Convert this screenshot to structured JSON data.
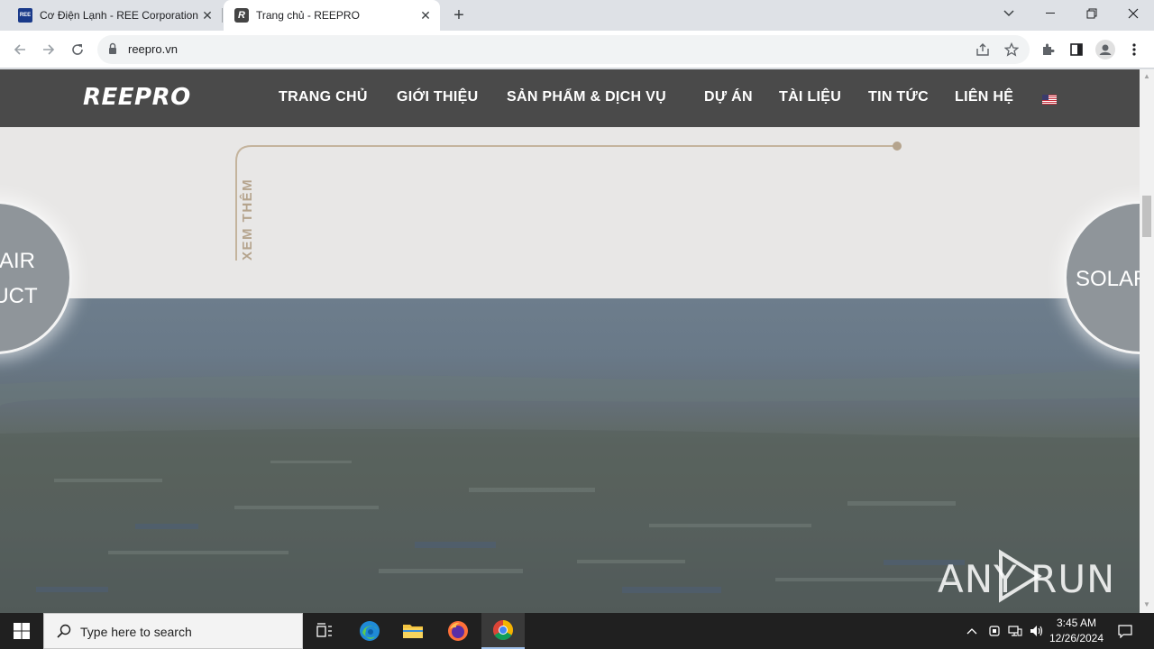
{
  "browser": {
    "tabs": [
      {
        "title": "Cơ Điện Lạnh - REE Corporation",
        "favicon": "REE",
        "active": false
      },
      {
        "title": "Trang chủ - REEPRO",
        "favicon": "R",
        "active": true
      }
    ],
    "address": "reepro.vn",
    "window_controls": [
      "tab-search",
      "minimize",
      "restore",
      "close"
    ]
  },
  "site": {
    "logo": "REEPRO",
    "menu": [
      "TRANG CHỦ",
      "GIỚI THIỆU",
      "SẢN PHẨM & DỊCH VỤ",
      "DỰ ÁN",
      "TÀI LIỆU",
      "TIN TỨC",
      "LIÊN HỆ"
    ],
    "language_flag": "us-flag-icon",
    "xem_them": "XEM THÊM",
    "left_circle": {
      "line1": "AIR",
      "line2": "DUCT"
    },
    "right_circle": {
      "line1": "SOLAR"
    }
  },
  "watermark": "ANY RUN",
  "taskbar": {
    "search_placeholder": "Type here to search",
    "time": "3:45 AM",
    "date": "12/26/2024"
  },
  "colors": {
    "nav_bg": "#4a4a4a",
    "accent_gold": "#b5a48d",
    "page_bg": "#e8e7e6"
  }
}
